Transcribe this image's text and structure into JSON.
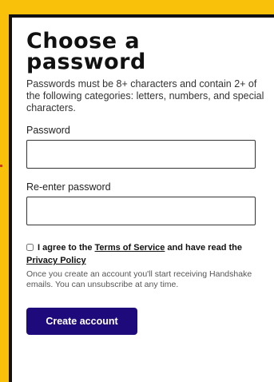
{
  "form": {
    "title": "Choose a password",
    "subtitle": "Passwords must be 8+ characters and contain 2+ of the following categories: letters, numbers, and special characters.",
    "password_label": "Password",
    "password_value": "",
    "reenter_label": "Re-enter password",
    "reenter_value": "",
    "agree": {
      "prefix": "I agree to the ",
      "terms_link": "Terms of Service",
      "middle": " and have read the ",
      "privacy_link": "Privacy Policy",
      "checked": false
    },
    "note": "Once you create an account you'll start receiving Handshake emails. You can unsubscribe at any time.",
    "create_button": "Create account"
  },
  "colors": {
    "page_background": "#f9c10a",
    "button_background": "#1e0a7a",
    "card_border": "#111111"
  }
}
